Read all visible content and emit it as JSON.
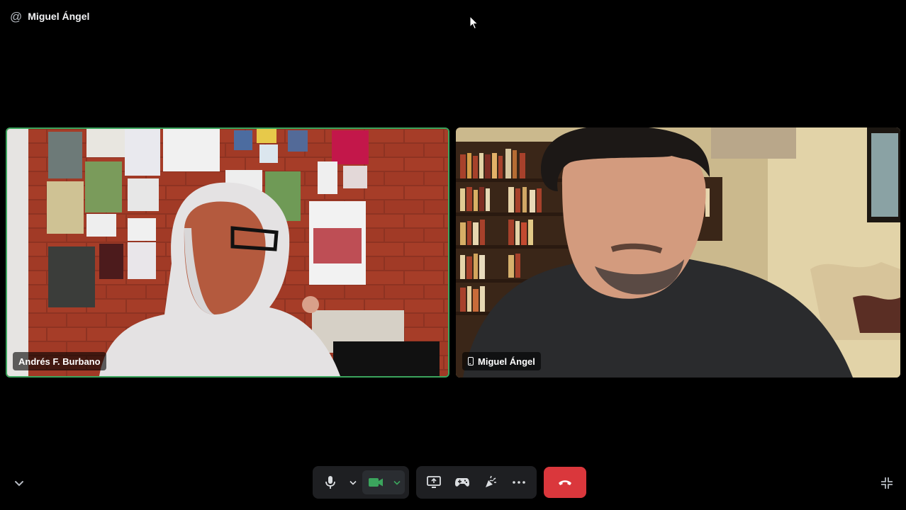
{
  "header": {
    "title": "Miguel Ángel",
    "icon": "at-sign-icon"
  },
  "participants": [
    {
      "name": "Andrés F. Burbano",
      "speaking": true,
      "device": "desktop"
    },
    {
      "name": "Miguel Ángel",
      "speaking": false,
      "device": "mobile"
    }
  ],
  "controls": {
    "mic": "microphone-icon",
    "camera_active": true,
    "buttons": [
      "share-screen-icon",
      "activity-gamepad-icon",
      "soundboard-icon",
      "more-options-icon"
    ],
    "leave": "hang-up-icon"
  },
  "colors": {
    "speaking_ring": "#3ba55d",
    "camera_on": "#3ba55d",
    "leave": "#da373c",
    "bar": "#1e1f22"
  }
}
